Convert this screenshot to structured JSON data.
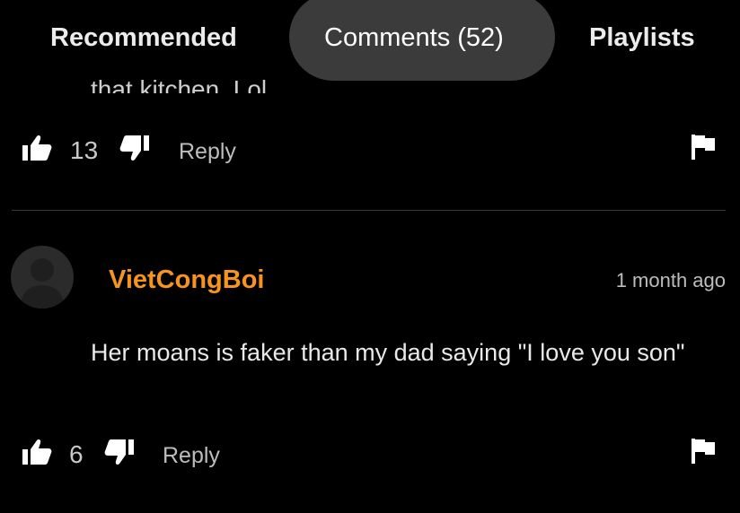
{
  "tabs": {
    "recommended": "Recommended",
    "comments": "Comments (52)",
    "playlists": "Playlists"
  },
  "previous_comment": {
    "truncated_text": "that kitchen. Lol",
    "like_count": "13",
    "reply_label": "Reply",
    "icons": [
      "thumbs-up-icon",
      "thumbs-down-icon",
      "flag-icon"
    ]
  },
  "comment": {
    "username": "VietCongBoi",
    "timestamp": "1 month ago",
    "text": "Her moans is faker than my dad saying \"I love you son\"",
    "like_count": "6",
    "reply_label": "Reply",
    "avatar_icon": "default-avatar-icon",
    "icons": [
      "thumbs-up-icon",
      "thumbs-down-icon",
      "flag-icon"
    ]
  },
  "colors": {
    "background": "#000000",
    "username": "#f7941d",
    "active_tab_bg": "#3b3b3b",
    "divider": "#3a3a3a"
  }
}
